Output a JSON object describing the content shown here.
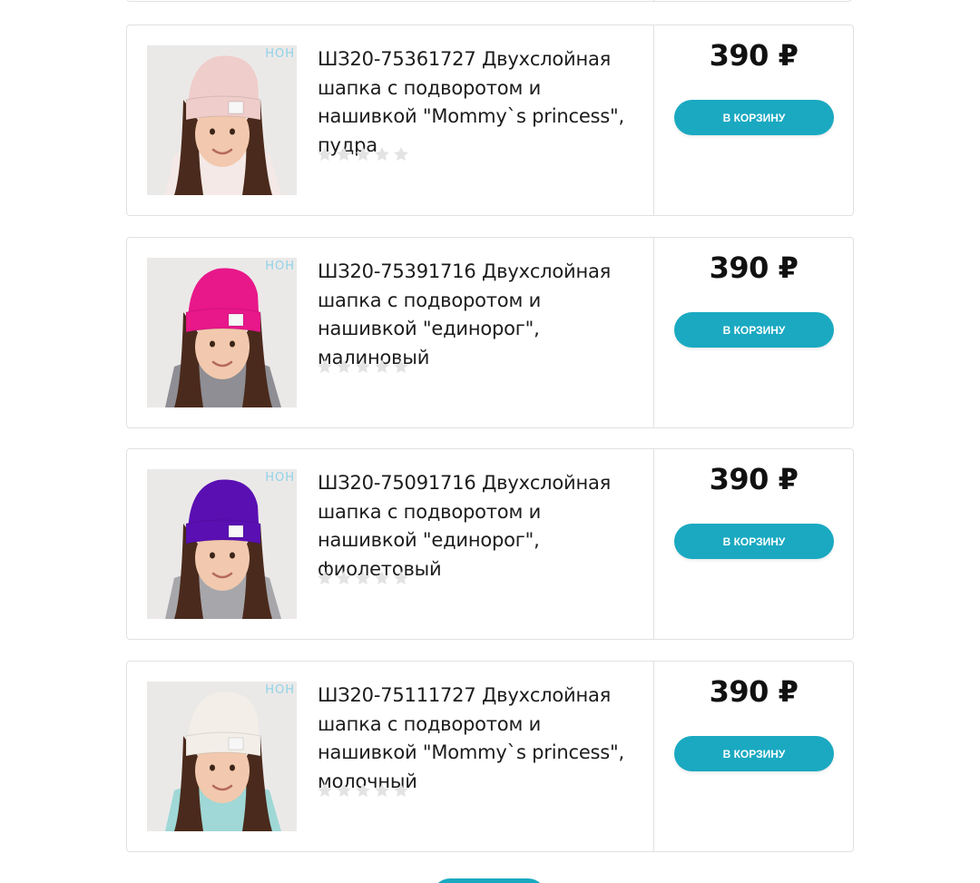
{
  "products": [
    {
      "title": "ШЗ20-75361727 Двухслойная шапка с подворотом и нашивкой \"Mommy`s princess\", пудра",
      "price": "390 ₽",
      "button_label": "В КОРЗИНУ",
      "rating": 0,
      "rating_max": 5,
      "hat_color": "#efcdca",
      "clothing_color": "#f4e9e6",
      "brand_mark": "НОН"
    },
    {
      "title": "ШЗ20-75391716 Двухслойная шапка с подворотом и нашивкой \"единорог\", малиновый",
      "price": "390 ₽",
      "button_label": "В КОРЗИНУ",
      "rating": 0,
      "rating_max": 5,
      "hat_color": "#e8178a",
      "clothing_color": "#8e8e94",
      "brand_mark": "НОН"
    },
    {
      "title": "ШЗ20-75091716 Двухслойная шапка с подворотом и нашивкой \"единорог\", фиолетовый",
      "price": "390 ₽",
      "button_label": "В КОРЗИНУ",
      "rating": 0,
      "rating_max": 5,
      "hat_color": "#5a0fb3",
      "clothing_color": "#a7a7ab",
      "brand_mark": "НОН"
    },
    {
      "title": "ШЗ20-75111727 Двухслойная шапка с подворотом и нашивкой \"Mommy`s princess\", молочный",
      "price": "390 ₽",
      "button_label": "В КОРЗИНУ",
      "rating": 0,
      "rating_max": 5,
      "hat_color": "#f3efe8",
      "clothing_color": "#9fd8d6",
      "brand_mark": "НОН"
    }
  ],
  "colors": {
    "accent": "#1aa9c1",
    "border": "#e1e1e1",
    "star_empty": "#e3e3e3"
  }
}
